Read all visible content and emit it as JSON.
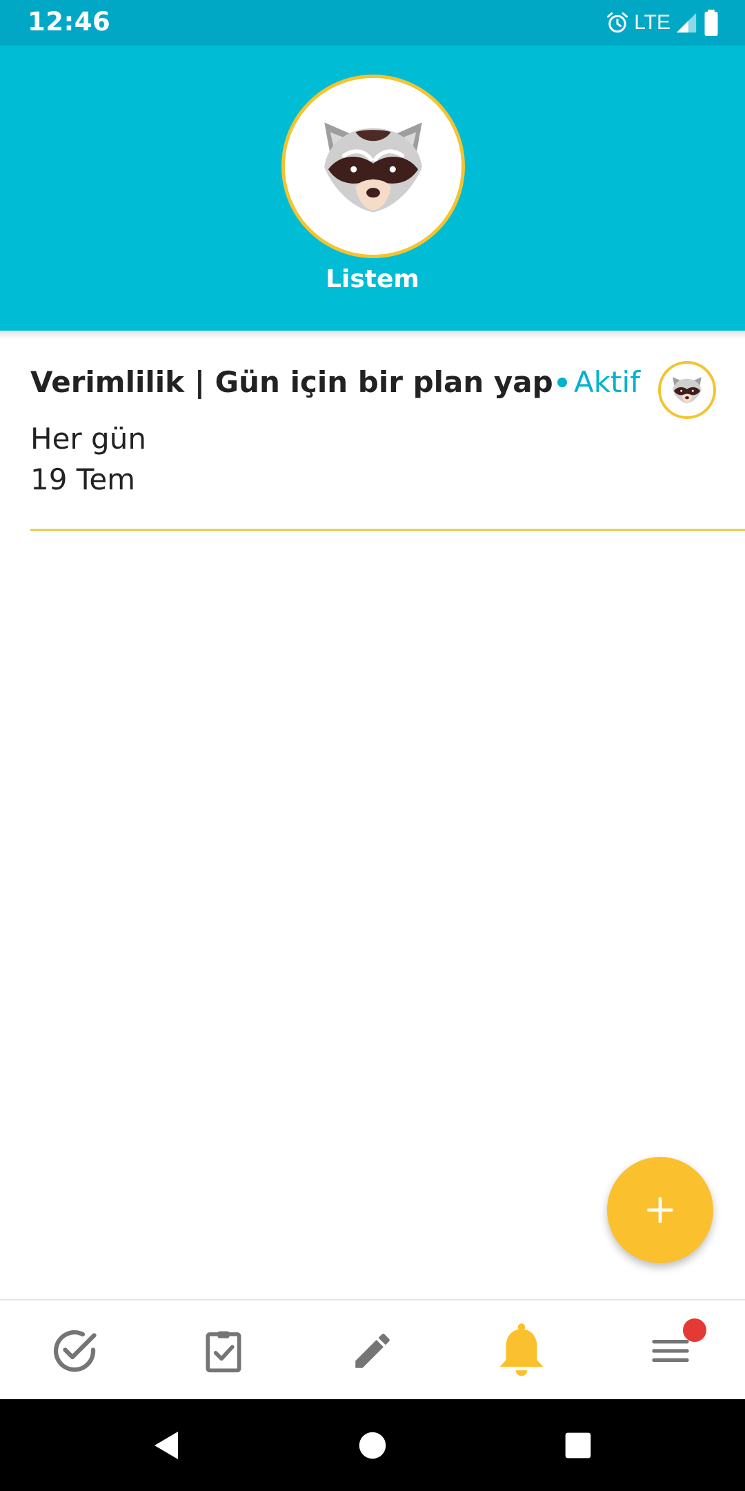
{
  "status_bar": {
    "time": "12:46",
    "network": "LTE",
    "icons": [
      "alarm-icon",
      "signal-icon",
      "battery-icon"
    ]
  },
  "header": {
    "title": "Listem",
    "avatar": "raccoon-avatar"
  },
  "list": {
    "items": [
      {
        "title": "Verimlilik | Gün için bir plan yap",
        "status": "Aktif",
        "frequency": "Her gün",
        "date": "19 Tem",
        "avatar": "raccoon-avatar"
      }
    ]
  },
  "fab": {
    "icon": "plus-icon"
  },
  "bottom_nav": {
    "items": [
      {
        "icon": "check-circle-icon",
        "active": false
      },
      {
        "icon": "clipboard-check-icon",
        "active": false
      },
      {
        "icon": "pencil-icon",
        "active": false
      },
      {
        "icon": "bell-icon",
        "active": true
      },
      {
        "icon": "menu-icon",
        "active": false,
        "badge": true
      }
    ]
  },
  "system_nav": {
    "icons": [
      "back-icon",
      "home-icon",
      "recents-icon"
    ]
  },
  "colors": {
    "primary": "#00bcd4",
    "status_bar": "#00a8c6",
    "accent": "#fbc02d",
    "active_status": "#00b3cc",
    "badge": "#e53935",
    "inactive_icon": "#757575"
  }
}
